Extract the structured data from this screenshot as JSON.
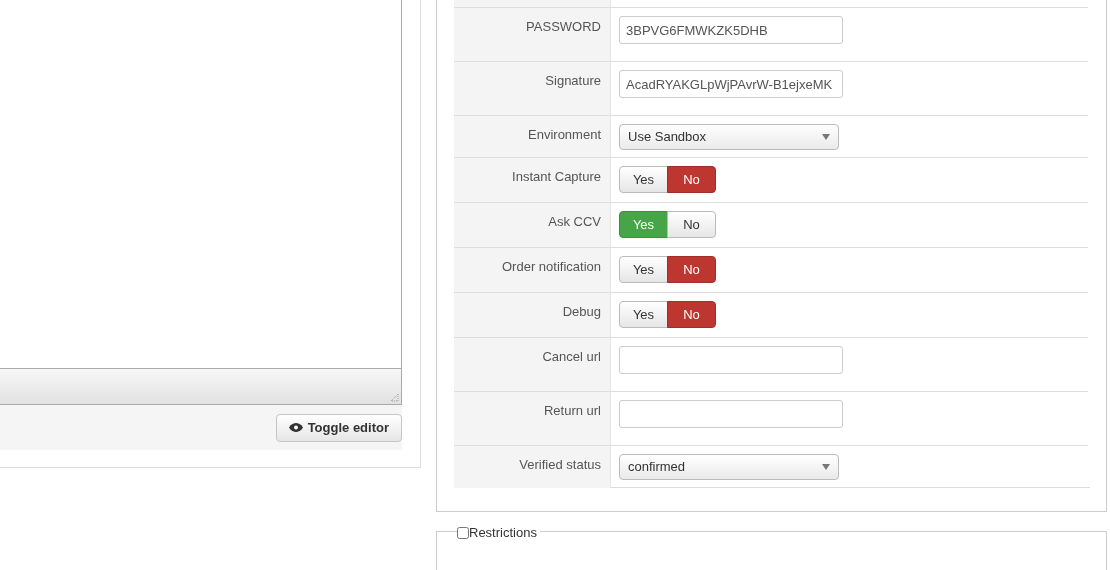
{
  "editor": {
    "toggle_button": "Toggle editor"
  },
  "settings": [
    {
      "kind": "text",
      "label": "PASSWORD",
      "value": "3BPVG6FMWKZK5DHB"
    },
    {
      "kind": "text",
      "label": "Signature",
      "value": "AcadRYAKGLpWjPAvrW-B1ejxeMK"
    },
    {
      "kind": "select",
      "label": "Environment",
      "value": "Use Sandbox"
    },
    {
      "kind": "toggle",
      "label": "Instant Capture",
      "options": [
        {
          "label": "Yes",
          "selected": false
        },
        {
          "label": "No",
          "selected": true
        }
      ]
    },
    {
      "kind": "toggle",
      "label": "Ask CCV",
      "options": [
        {
          "label": "Yes",
          "selected": true
        },
        {
          "label": "No",
          "selected": false
        }
      ]
    },
    {
      "kind": "toggle",
      "label": "Order notification",
      "options": [
        {
          "label": "Yes",
          "selected": false
        },
        {
          "label": "No",
          "selected": true
        }
      ]
    },
    {
      "kind": "toggle",
      "label": "Debug",
      "options": [
        {
          "label": "Yes",
          "selected": false
        },
        {
          "label": "No",
          "selected": true
        }
      ]
    },
    {
      "kind": "text",
      "label": "Cancel url"
    },
    {
      "kind": "text",
      "label": "Return url"
    },
    {
      "kind": "select",
      "label": "Verified status",
      "value": "confirmed"
    }
  ],
  "restrictions": {
    "label": "Restrictions",
    "checked": false
  }
}
